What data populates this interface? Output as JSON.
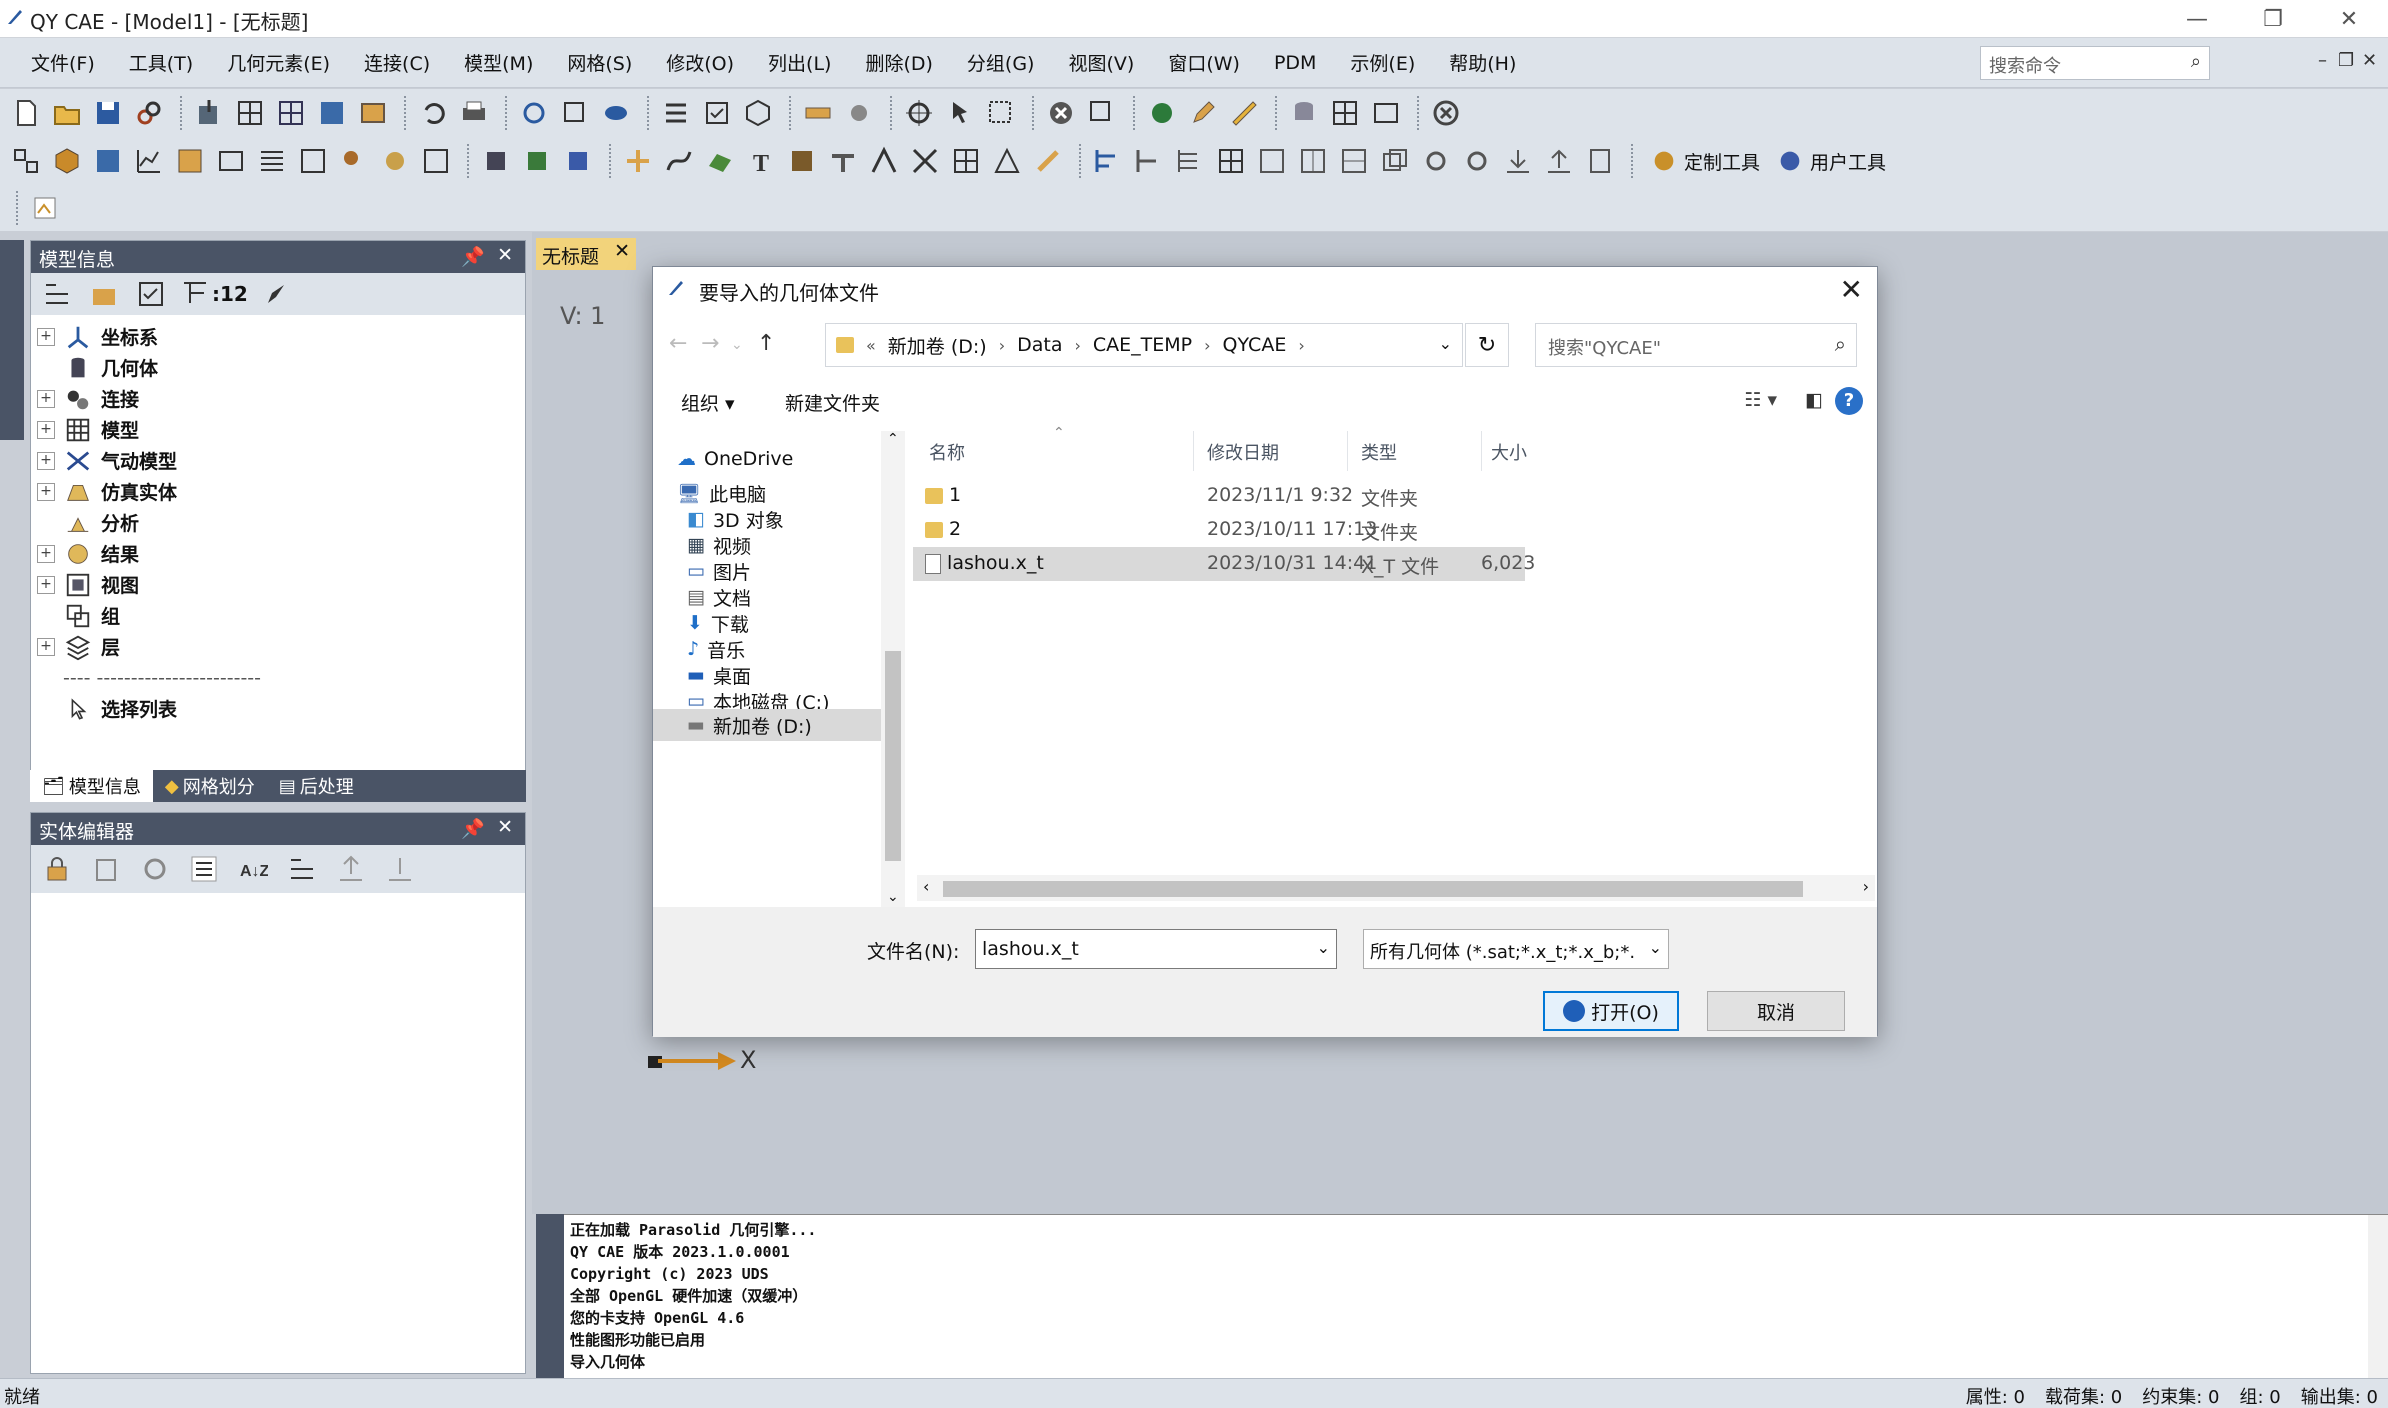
{
  "window": {
    "title": "QY CAE - [Model1] - [无标题]",
    "controls": {
      "minimize": "—",
      "maximize": "❐",
      "close": "✕"
    }
  },
  "menu": [
    "文件(F)",
    "工具(T)",
    "几何元素(E)",
    "连接(C)",
    "模型(M)",
    "网格(S)",
    "修改(O)",
    "列出(L)",
    "删除(D)",
    "分组(G)",
    "视图(V)",
    "窗口(W)",
    "PDM",
    "示例(E)",
    "帮助(H)"
  ],
  "search_command": {
    "placeholder": "搜索命令"
  },
  "toolbar": {
    "counter_label": ":12",
    "custom_tools": "定制工具",
    "user_tools": "用户工具"
  },
  "model_panel": {
    "title": "模型信息",
    "tree": [
      {
        "label": "坐标系",
        "expandable": true
      },
      {
        "label": "几何体",
        "expandable": false
      },
      {
        "label": "连接",
        "expandable": true
      },
      {
        "label": "模型",
        "expandable": true
      },
      {
        "label": "气动模型",
        "expandable": true
      },
      {
        "label": "仿真实体",
        "expandable": true
      },
      {
        "label": "分析",
        "expandable": false
      },
      {
        "label": "结果",
        "expandable": true
      },
      {
        "label": "视图",
        "expandable": true
      },
      {
        "label": "组",
        "expandable": false
      },
      {
        "label": "层",
        "expandable": true
      }
    ],
    "selection_list": "选择列表",
    "tabs": [
      "模型信息",
      "网格划分",
      "后处理"
    ]
  },
  "entity_panel": {
    "title": "实体编辑器"
  },
  "document": {
    "tab": "无标题",
    "view_label": "V: 1",
    "axis_label": "X"
  },
  "dialog": {
    "title": "要导入的几何体文件",
    "breadcrumbs": [
      "新加卷 (D:)",
      "Data",
      "CAE_TEMP",
      "QYCAE"
    ],
    "search_placeholder": "搜索\"QYCAE\"",
    "organize": "组织 ▾",
    "new_folder": "新建文件夹",
    "help": "?",
    "nav": [
      {
        "label": "OneDrive",
        "icon": "cloud-icon"
      },
      {
        "label": "此电脑",
        "icon": "computer-icon"
      },
      {
        "label": "3D 对象",
        "icon": "cube-icon"
      },
      {
        "label": "视频",
        "icon": "video-icon"
      },
      {
        "label": "图片",
        "icon": "picture-icon"
      },
      {
        "label": "文档",
        "icon": "document-icon"
      },
      {
        "label": "下载",
        "icon": "download-icon"
      },
      {
        "label": "音乐",
        "icon": "music-icon"
      },
      {
        "label": "桌面",
        "icon": "desktop-icon"
      },
      {
        "label": "本地磁盘 (C:)",
        "icon": "disk-icon"
      },
      {
        "label": "新加卷 (D:)",
        "icon": "disk-icon",
        "selected": true
      }
    ],
    "columns": [
      "名称",
      "修改日期",
      "类型",
      "大小"
    ],
    "files": [
      {
        "name": "1",
        "date": "2023/11/1 9:32",
        "type": "文件夹",
        "size": "",
        "kind": "folder"
      },
      {
        "name": "2",
        "date": "2023/10/11 17:13",
        "type": "文件夹",
        "size": "",
        "kind": "folder"
      },
      {
        "name": "lashou.x_t",
        "date": "2023/10/31 14:41",
        "type": "X_T 文件",
        "size": "6,023",
        "kind": "file",
        "selected": true
      }
    ],
    "filename_label": "文件名(N):",
    "filename_value": "lashou.x_t",
    "filetype": "所有几何体 (*.sat;*.x_t;*.x_b;*.",
    "open_button": "打开(O)",
    "cancel_button": "取消"
  },
  "console": [
    "正在加载 Parasolid 几何引擎...",
    "QY CAE 版本 2023.1.0.0001",
    "Copyright (c) 2023 UDS",
    "全部 OpenGL 硬件加速（双缓冲）",
    "您的卡支持 OpenGL 4.6",
    "性能图形功能已启用",
    "导入几何体"
  ],
  "status": {
    "left": "就绪",
    "items": [
      "属性: 0",
      "载荷集: 0",
      "约束集: 0",
      "组: 0",
      "输出集: 0"
    ]
  }
}
